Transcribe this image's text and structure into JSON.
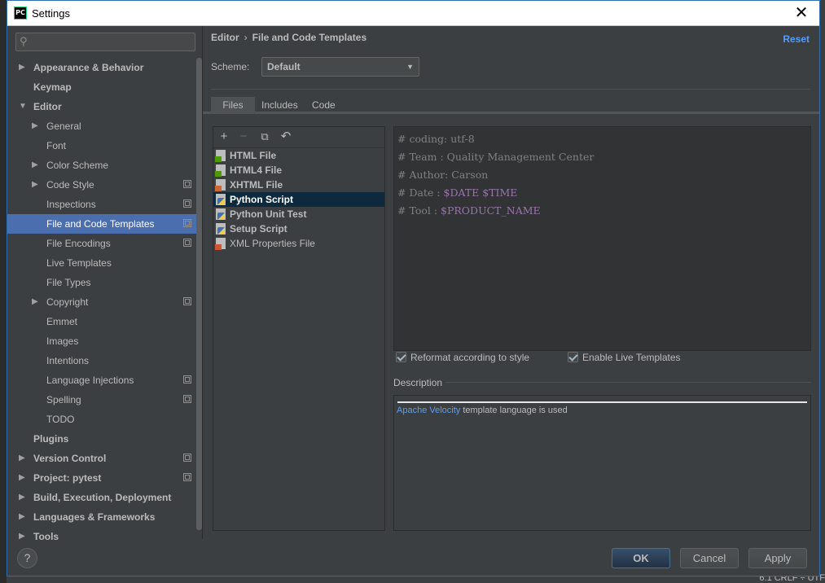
{
  "window": {
    "title": "Settings",
    "app_icon": "PC",
    "close": "✕"
  },
  "search": {
    "icon": "search-icon"
  },
  "tree": [
    {
      "label": "Appearance & Behavior",
      "level": 0,
      "bold": true,
      "arrow": "▶"
    },
    {
      "label": "Keymap",
      "level": 0,
      "bold": true
    },
    {
      "label": "Editor",
      "level": 0,
      "bold": true,
      "arrow": "▼"
    },
    {
      "label": "General",
      "level": 1,
      "arrow": "▶"
    },
    {
      "label": "Font",
      "level": 1
    },
    {
      "label": "Color Scheme",
      "level": 1,
      "arrow": "▶"
    },
    {
      "label": "Code Style",
      "level": 1,
      "arrow": "▶",
      "copy": true
    },
    {
      "label": "Inspections",
      "level": 1,
      "copy": true
    },
    {
      "label": "File and Code Templates",
      "level": 1,
      "copy": true,
      "selected": true
    },
    {
      "label": "File Encodings",
      "level": 1,
      "copy": true
    },
    {
      "label": "Live Templates",
      "level": 1
    },
    {
      "label": "File Types",
      "level": 1
    },
    {
      "label": "Copyright",
      "level": 1,
      "arrow": "▶",
      "copy": true
    },
    {
      "label": "Emmet",
      "level": 1
    },
    {
      "label": "Images",
      "level": 1
    },
    {
      "label": "Intentions",
      "level": 1
    },
    {
      "label": "Language Injections",
      "level": 1,
      "copy": true
    },
    {
      "label": "Spelling",
      "level": 1,
      "copy": true
    },
    {
      "label": "TODO",
      "level": 1
    },
    {
      "label": "Plugins",
      "level": 0,
      "bold": true
    },
    {
      "label": "Version Control",
      "level": 0,
      "bold": true,
      "arrow": "▶",
      "copy": true
    },
    {
      "label": "Project: pytest",
      "level": 0,
      "bold": true,
      "arrow": "▶",
      "copy": true
    },
    {
      "label": "Build, Execution, Deployment",
      "level": 0,
      "bold": true,
      "arrow": "▶"
    },
    {
      "label": "Languages & Frameworks",
      "level": 0,
      "bold": true,
      "arrow": "▶"
    },
    {
      "label": "Tools",
      "level": 0,
      "bold": true,
      "arrow": "▶"
    }
  ],
  "breadcrumb": {
    "parent": "Editor",
    "separator": "›",
    "current": "File and Code Templates"
  },
  "reset_label": "Reset",
  "scheme": {
    "label": "Scheme:",
    "value": "Default"
  },
  "tabs": {
    "files": "Files",
    "includes": "Includes",
    "code": "Code"
  },
  "toolbar": {
    "add": "+",
    "remove": "−",
    "copy": "⧉",
    "revert": "↶"
  },
  "templates": [
    {
      "label": "HTML File",
      "icon": "html-file-icon",
      "tag": "H",
      "tag_color": "#4e9a06"
    },
    {
      "label": "HTML4 File",
      "icon": "html4-file-icon",
      "tag": "H",
      "tag_color": "#4e9a06"
    },
    {
      "label": "XHTML File",
      "icon": "xhtml-file-icon",
      "tag": "H",
      "tag_color": "#cc6633"
    },
    {
      "label": "Python Script",
      "icon": "python-file-icon",
      "selected": true,
      "python": true
    },
    {
      "label": "Python Unit Test",
      "icon": "python-test-file-icon",
      "python": true
    },
    {
      "label": "Setup Script",
      "icon": "setup-script-icon",
      "python": true
    },
    {
      "label": "XML Properties File",
      "icon": "xml-file-icon",
      "tag": "<>",
      "tag_color": "#cc5533",
      "normal": true
    }
  ],
  "code_lines": [
    {
      "text": "# coding: utf-8",
      "var": ""
    },
    {
      "text": "# Team : Quality Management Center",
      "var": ""
    },
    {
      "text": "# Author: Carson",
      "var": ""
    },
    {
      "text": "# Date : ",
      "var": "$DATE $TIME"
    },
    {
      "text": "# Tool : ",
      "var": "$PRODUCT_NAME"
    }
  ],
  "options": {
    "reformat": "Reformat according to style",
    "live_templates": "Enable Live Templates"
  },
  "description": {
    "label": "Description",
    "link": "Apache Velocity",
    "text": " template language is used"
  },
  "buttons": {
    "help": "?",
    "ok": "OK",
    "cancel": "Cancel",
    "apply": "Apply"
  },
  "background": {
    "status": "6:1  CRLF ÷  UTF"
  }
}
